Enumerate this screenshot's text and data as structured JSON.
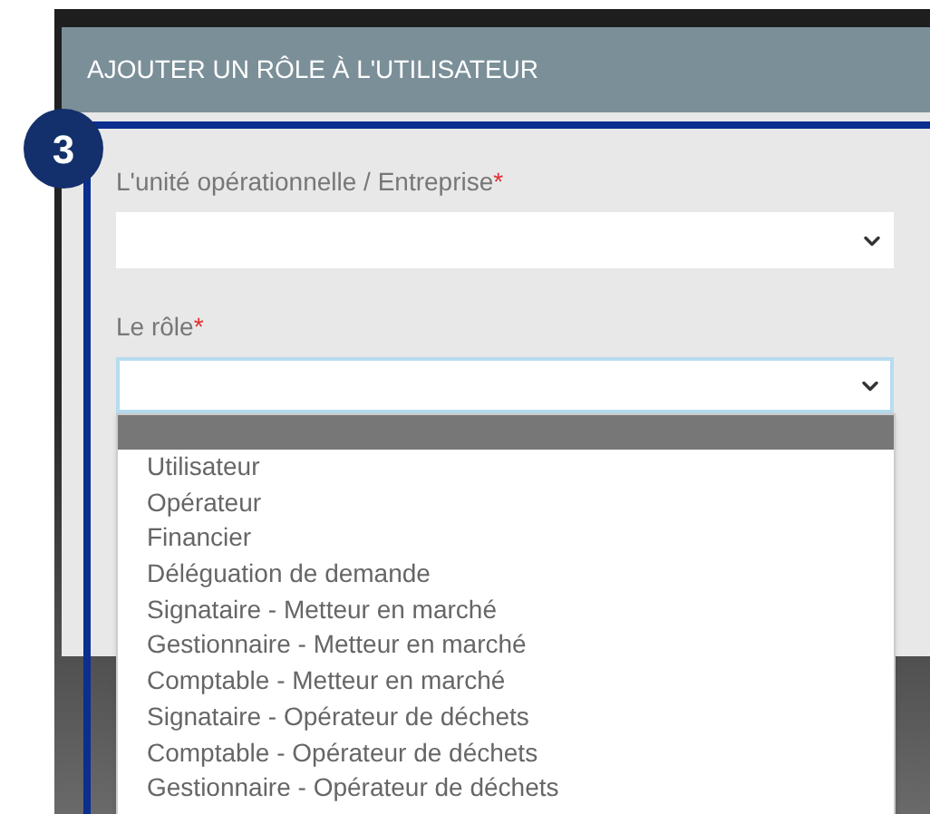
{
  "step_badge": "3",
  "dialog": {
    "title": "AJOUTER UN RÔLE À L'UTILISATEUR"
  },
  "fields": [
    {
      "label": "L'unité opérationnelle / Entreprise",
      "required_mark": "*",
      "focused": false
    },
    {
      "label": "Le rôle",
      "required_mark": "*",
      "focused": true
    }
  ],
  "role_dropdown": {
    "blank_option": {
      "selected": true
    },
    "options": [
      {
        "label": "Utilisateur",
        "selected": false
      },
      {
        "label": "Opérateur",
        "selected": false
      },
      {
        "label": "Financier",
        "selected": false
      },
      {
        "label": "Déléguation de demande",
        "selected": false
      },
      {
        "label": "Signataire - Metteur en marché",
        "selected": false
      },
      {
        "label": "Gestionnaire - Metteur en marché",
        "selected": false
      },
      {
        "label": "Comptable - Metteur en marché",
        "selected": false
      },
      {
        "label": "Signataire - Opérateur de déchets",
        "selected": false
      },
      {
        "label": "Comptable - Opérateur de déchets",
        "selected": false
      },
      {
        "label": "Gestionnaire - Opérateur de déchets",
        "selected": false
      }
    ]
  }
}
